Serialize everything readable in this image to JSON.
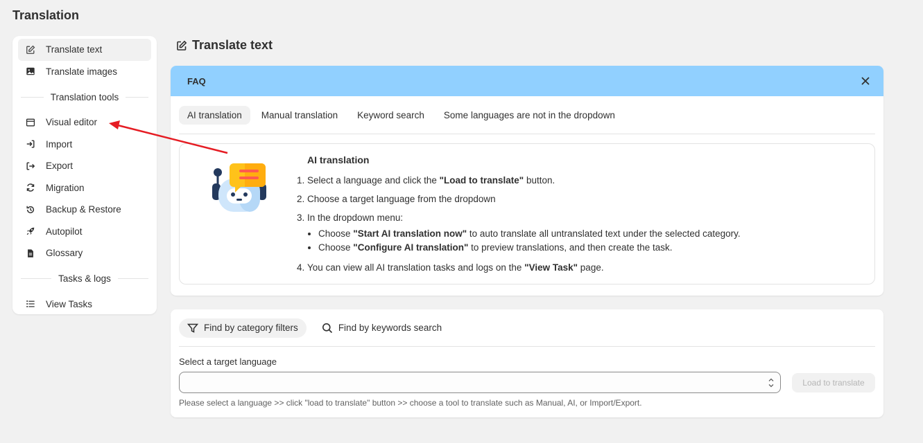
{
  "page": {
    "title": "Translation"
  },
  "sidebar": {
    "items": [
      {
        "label": "Translate text",
        "icon": "edit-icon",
        "active": true
      },
      {
        "label": "Translate images",
        "icon": "image-icon"
      }
    ],
    "tools_heading": "Translation tools",
    "tools": [
      {
        "label": "Visual editor",
        "icon": "browser-window-icon"
      },
      {
        "label": "Import",
        "icon": "import-icon"
      },
      {
        "label": "Export",
        "icon": "export-icon"
      },
      {
        "label": "Migration",
        "icon": "refresh-icon"
      },
      {
        "label": "Backup & Restore",
        "icon": "history-icon"
      },
      {
        "label": "Autopilot",
        "icon": "rocket-icon"
      },
      {
        "label": "Glossary",
        "icon": "document-icon"
      }
    ],
    "tasks_heading": "Tasks & logs",
    "tasks": [
      {
        "label": "View Tasks",
        "icon": "list-icon"
      }
    ]
  },
  "main": {
    "title": "Translate text",
    "faq": {
      "header": "FAQ",
      "tabs": [
        "AI translation",
        "Manual translation",
        "Keyword search",
        "Some languages are not in the dropdown"
      ],
      "active_tab": 0,
      "content": {
        "heading": "AI translation",
        "step1_pre": "Select a language and click the ",
        "step1_bold": "\"Load to translate\"",
        "step1_post": " button.",
        "step2": "Choose a target language from the dropdown",
        "step3": "In the dropdown menu:",
        "step3a_pre": "Choose ",
        "step3a_bold": "\"Start AI translation now\"",
        "step3a_post": " to auto translate all untranslated text under the selected category.",
        "step3b_pre": "Choose ",
        "step3b_bold": "\"Configure AI translation\"",
        "step3b_post": " to preview translations, and then create the task.",
        "step4_pre": "You can view all AI translation tasks and logs on the ",
        "step4_bold": "\"View Task\"",
        "step4_post": " page."
      }
    },
    "filters": {
      "tabs": [
        {
          "label": "Find by category filters",
          "icon": "filter-icon",
          "active": true
        },
        {
          "label": "Find by keywords search",
          "icon": "search-icon"
        }
      ],
      "language_label": "Select a target language",
      "select_value": "",
      "load_button": "Load to translate",
      "helper": "Please select a language >> click \"load to translate\" button >> choose a tool to translate such as Manual, AI, or Import/Export."
    }
  },
  "colors": {
    "faq_header": "#91d0ff",
    "annotation_arrow": "#e51c23",
    "background": "#f1f1f1"
  }
}
